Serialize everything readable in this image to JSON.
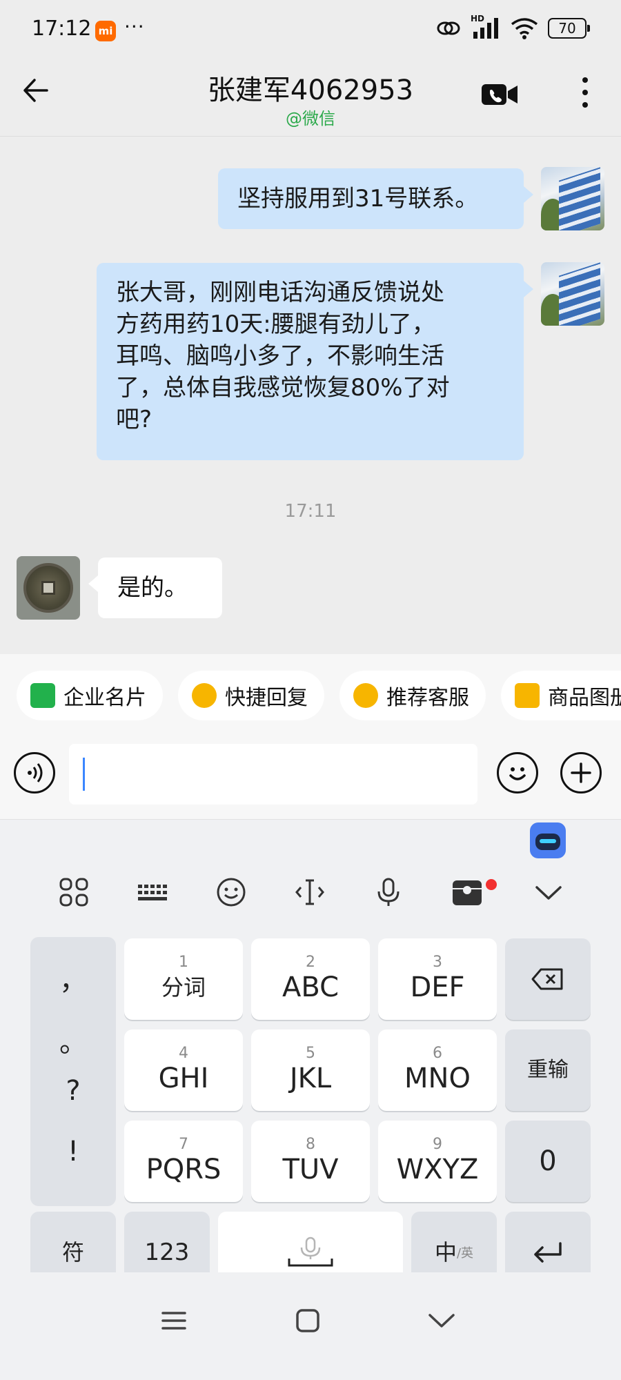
{
  "status_bar": {
    "time": "17:12",
    "mi": "mi",
    "dots": "···",
    "hd": "HD",
    "battery": "70"
  },
  "header": {
    "title": "张建军4062953",
    "subtitle": "@微信"
  },
  "messages": [
    {
      "from": "me",
      "text": "坚持服用到31号联系。"
    },
    {
      "from": "me",
      "lines": [
        "张大哥，刚刚电话沟通反馈说处",
        "方药用药10天:腰腿有劲儿了，",
        "耳鸣、脑鸣小多了，不影响生活",
        "了，总体自我感觉恢复80%了对",
        "吧?"
      ]
    },
    {
      "from": "them",
      "text": "是的。"
    }
  ],
  "timestamp": "17:11",
  "chips": [
    {
      "label": "企业名片",
      "icon": "business-card-icon"
    },
    {
      "label": "快捷回复",
      "icon": "quick-reply-icon"
    },
    {
      "label": "推荐客服",
      "icon": "recommend-service-icon"
    },
    {
      "label": "商品图册",
      "icon": "product-album-icon"
    }
  ],
  "input": {
    "value": "",
    "placeholder": ""
  },
  "keyboard": {
    "punctuation": [
      "，",
      "。",
      "?",
      "!"
    ],
    "keys": [
      {
        "num": "1",
        "label": "分词"
      },
      {
        "num": "2",
        "label": "ABC"
      },
      {
        "num": "3",
        "label": "DEF"
      },
      {
        "num": "4",
        "label": "GHI"
      },
      {
        "num": "5",
        "label": "JKL"
      },
      {
        "num": "6",
        "label": "MNO"
      },
      {
        "num": "7",
        "label": "PQRS"
      },
      {
        "num": "8",
        "label": "TUV"
      },
      {
        "num": "9",
        "label": "WXYZ"
      }
    ],
    "reenter": "重输",
    "zero": "0",
    "symbols": "符",
    "numbers": "123",
    "lang_main": "中",
    "lang_sub": "/英"
  },
  "colors": {
    "my_bubble": "#cde4fb",
    "their_bubble": "#ffffff",
    "wechat_green": "#2ca94b",
    "background": "#ededed"
  }
}
